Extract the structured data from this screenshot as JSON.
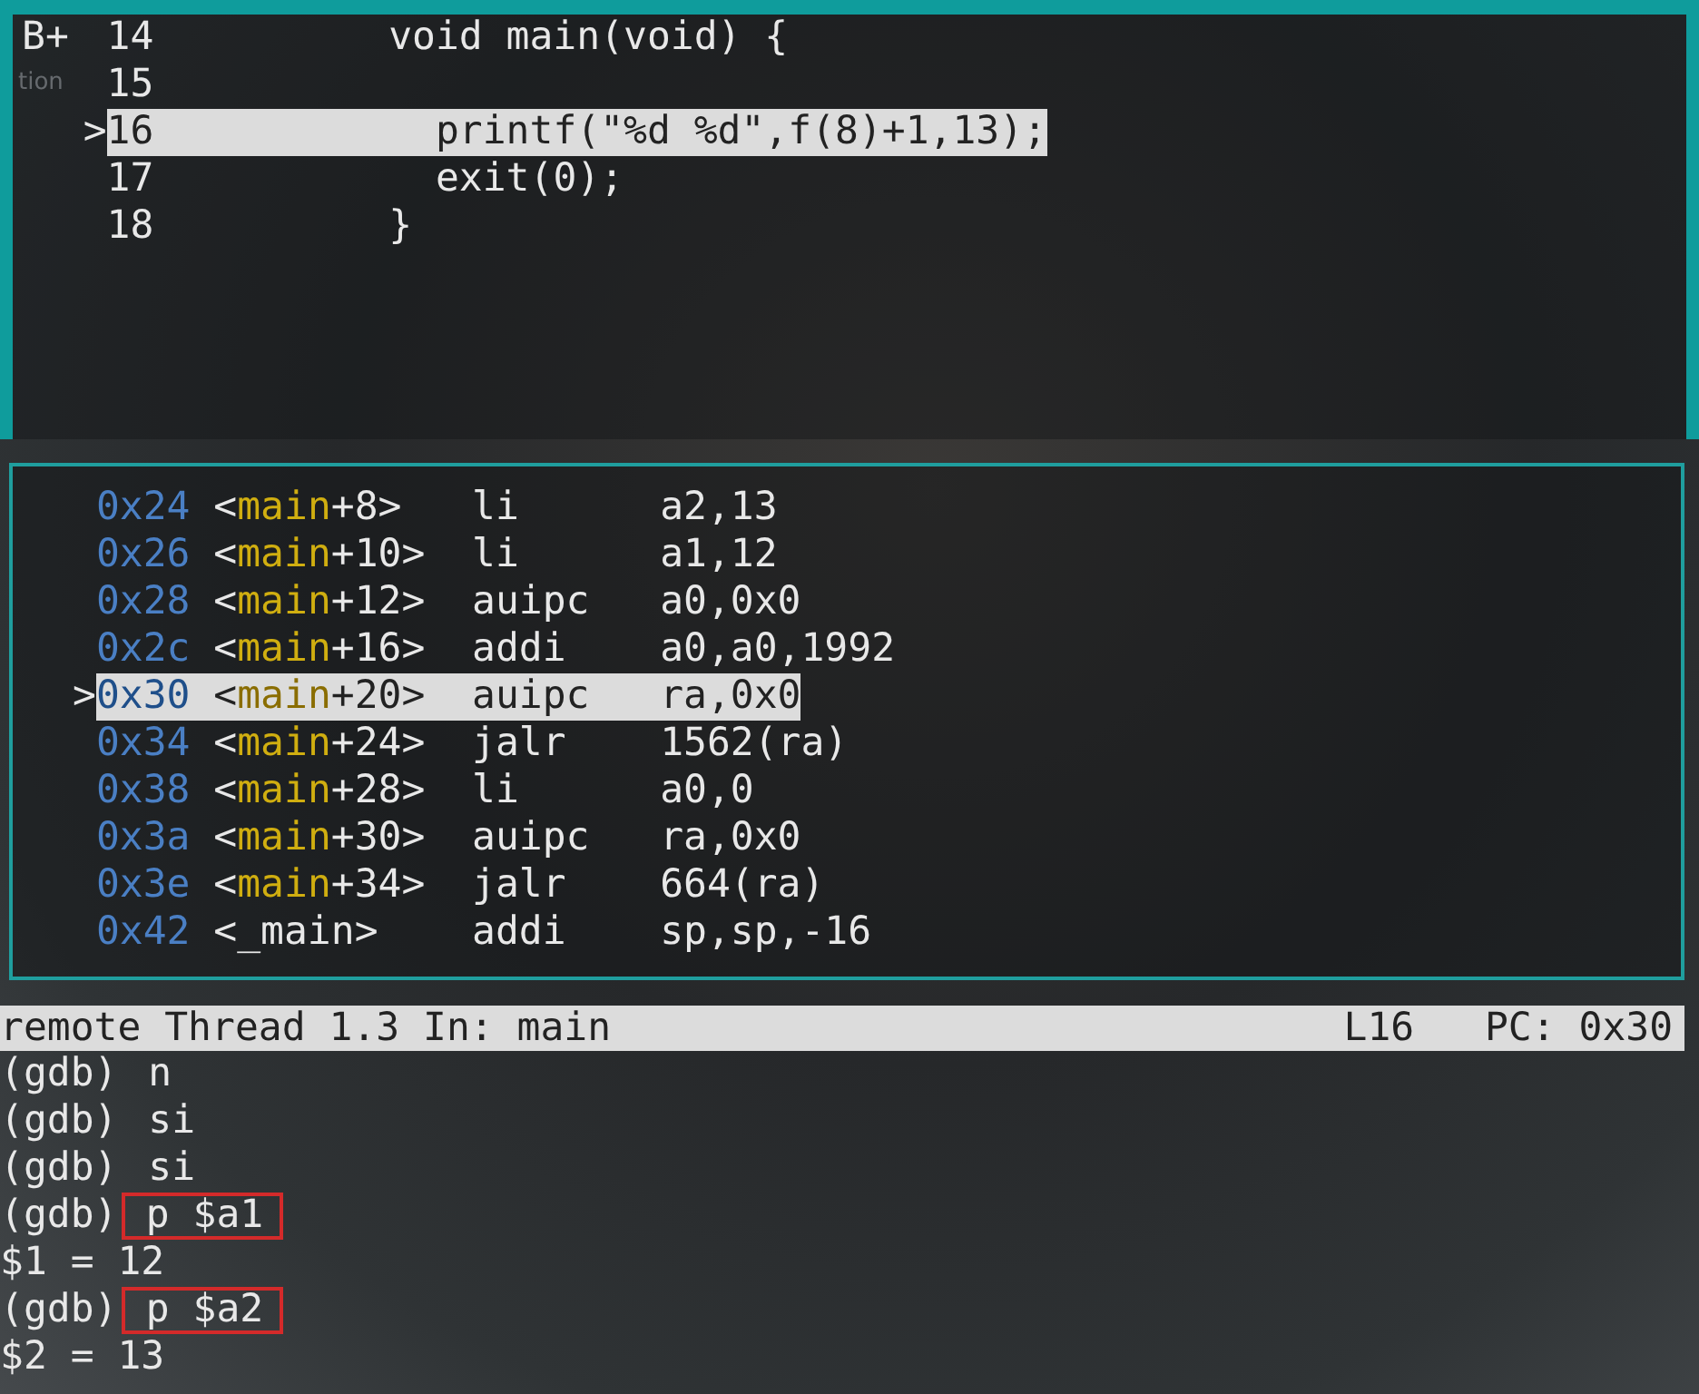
{
  "side_fragment": "tion",
  "source": {
    "lines": [
      {
        "marker": {
          "text": "B+",
          "kind": "breakpoint"
        },
        "number": "14",
        "code": "void main(void) {",
        "selected": false,
        "children": [
          {
            "number": "15",
            "selected": false
          },
          {
            "marker": {
              "text": ">",
              "kind": "current"
            },
            "number": "16",
            "code": "printf(\"%d %d\",f(8)+1,13);",
            "selected": true
          },
          {
            "number": "17",
            "code": "exit(0);",
            "selected": false
          }
        ]
      },
      {
        "number": "18",
        "code": "}",
        "selected": false
      }
    ]
  },
  "disassembly": {
    "rows": [
      {
        "address": "0x24",
        "symbol": [
          {
            "text": "<",
            "kind": "plain"
          },
          {
            "text": "main",
            "kind": "function"
          },
          {
            "text": "+8>",
            "kind": "plain"
          }
        ],
        "mnemonic": "li",
        "operands": "a2,13",
        "selected": false
      },
      {
        "address": "0x26",
        "symbol": [
          {
            "text": "<",
            "kind": "plain"
          },
          {
            "text": "main",
            "kind": "function"
          },
          {
            "text": "+10>",
            "kind": "plain"
          }
        ],
        "mnemonic": "li",
        "operands": "a1,12",
        "selected": false
      },
      {
        "address": "0x28",
        "symbol": [
          {
            "text": "<",
            "kind": "plain"
          },
          {
            "text": "main",
            "kind": "function"
          },
          {
            "text": "+12>",
            "kind": "plain"
          }
        ],
        "mnemonic": "auipc",
        "operands": "a0,0x0",
        "selected": false
      },
      {
        "address": "0x2c",
        "symbol": [
          {
            "text": "<",
            "kind": "plain"
          },
          {
            "text": "main",
            "kind": "function"
          },
          {
            "text": "+16>",
            "kind": "plain"
          }
        ],
        "mnemonic": "addi",
        "operands": "a0,a0,1992",
        "selected": false
      },
      {
        "marker": ">",
        "address": "0x30",
        "symbol": [
          {
            "text": "<",
            "kind": "plain"
          },
          {
            "text": "main",
            "kind": "function"
          },
          {
            "text": "+20>",
            "kind": "plain"
          }
        ],
        "mnemonic": "auipc",
        "operands": "ra,0x0",
        "selected": true
      },
      {
        "address": "0x34",
        "symbol": [
          {
            "text": "<",
            "kind": "plain"
          },
          {
            "text": "main",
            "kind": "function"
          },
          {
            "text": "+24>",
            "kind": "plain"
          }
        ],
        "mnemonic": "jalr",
        "operands": "1562(ra)",
        "selected": false
      },
      {
        "address": "0x38",
        "symbol": [
          {
            "text": "<",
            "kind": "plain"
          },
          {
            "text": "main",
            "kind": "function"
          },
          {
            "text": "+28>",
            "kind": "plain"
          }
        ],
        "mnemonic": "li",
        "operands": "a0,0",
        "selected": false
      },
      {
        "address": "0x3a",
        "symbol": [
          {
            "text": "<",
            "kind": "plain"
          },
          {
            "text": "main",
            "kind": "function"
          },
          {
            "text": "+30>",
            "kind": "plain"
          }
        ],
        "mnemonic": "auipc",
        "operands": "ra,0x0",
        "selected": false
      },
      {
        "address": "0x3e",
        "symbol": [
          {
            "text": "<",
            "kind": "plain"
          },
          {
            "text": "main",
            "kind": "function"
          },
          {
            "text": "+34>",
            "kind": "plain"
          }
        ],
        "mnemonic": "jalr",
        "operands": "664(ra)",
        "selected": false
      },
      {
        "address": "0x42",
        "symbol": [
          {
            "text": "<_main>",
            "kind": "plain"
          }
        ],
        "mnemonic": "addi",
        "operands": "sp,sp,-16",
        "selected": false
      }
    ]
  },
  "status_bar": {
    "target": "remote Thread 1.3 In: main",
    "line": "L16",
    "pc": "PC: 0x30"
  },
  "console": [
    {
      "kind": "command",
      "prompt": "(gdb)",
      "text": "n",
      "highlighted": false
    },
    {
      "kind": "command",
      "prompt": "(gdb)",
      "text": "si",
      "highlighted": false
    },
    {
      "kind": "command",
      "prompt": "(gdb)",
      "text": "si",
      "highlighted": false
    },
    {
      "kind": "command",
      "prompt": "(gdb)",
      "text": "p $a1",
      "highlighted": true
    },
    {
      "kind": "output",
      "text": "$1 = 12"
    },
    {
      "kind": "command",
      "prompt": "(gdb)",
      "text": "p $a2",
      "highlighted": true
    },
    {
      "kind": "output",
      "text": "$2 = 13"
    }
  ]
}
